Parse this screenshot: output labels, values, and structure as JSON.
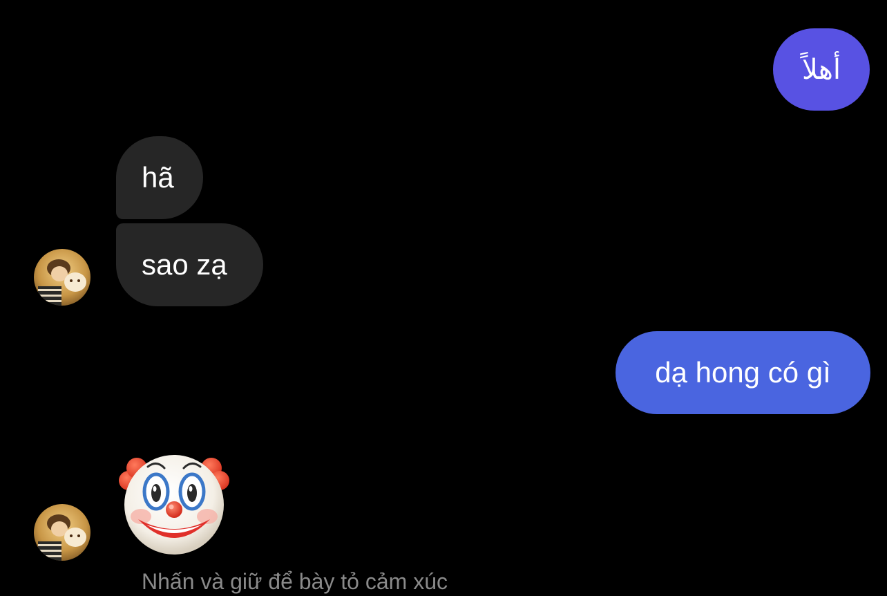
{
  "colors": {
    "background": "#000000",
    "sent_bubble_top": "#5852e3",
    "sent_bubble_bottom": "#4a65e0",
    "received_bubble": "#262626",
    "hint_text": "#8a8a8a"
  },
  "messages": [
    {
      "direction": "sent",
      "text": "أهلاً"
    },
    {
      "direction": "received",
      "text": "hã"
    },
    {
      "direction": "received",
      "text": "sao zạ"
    },
    {
      "direction": "sent",
      "text": "dạ hong có gì"
    },
    {
      "direction": "received",
      "emoji": "clown-face"
    }
  ],
  "hint": {
    "text": "Nhấn và giữ để bày tỏ cảm xúc"
  }
}
